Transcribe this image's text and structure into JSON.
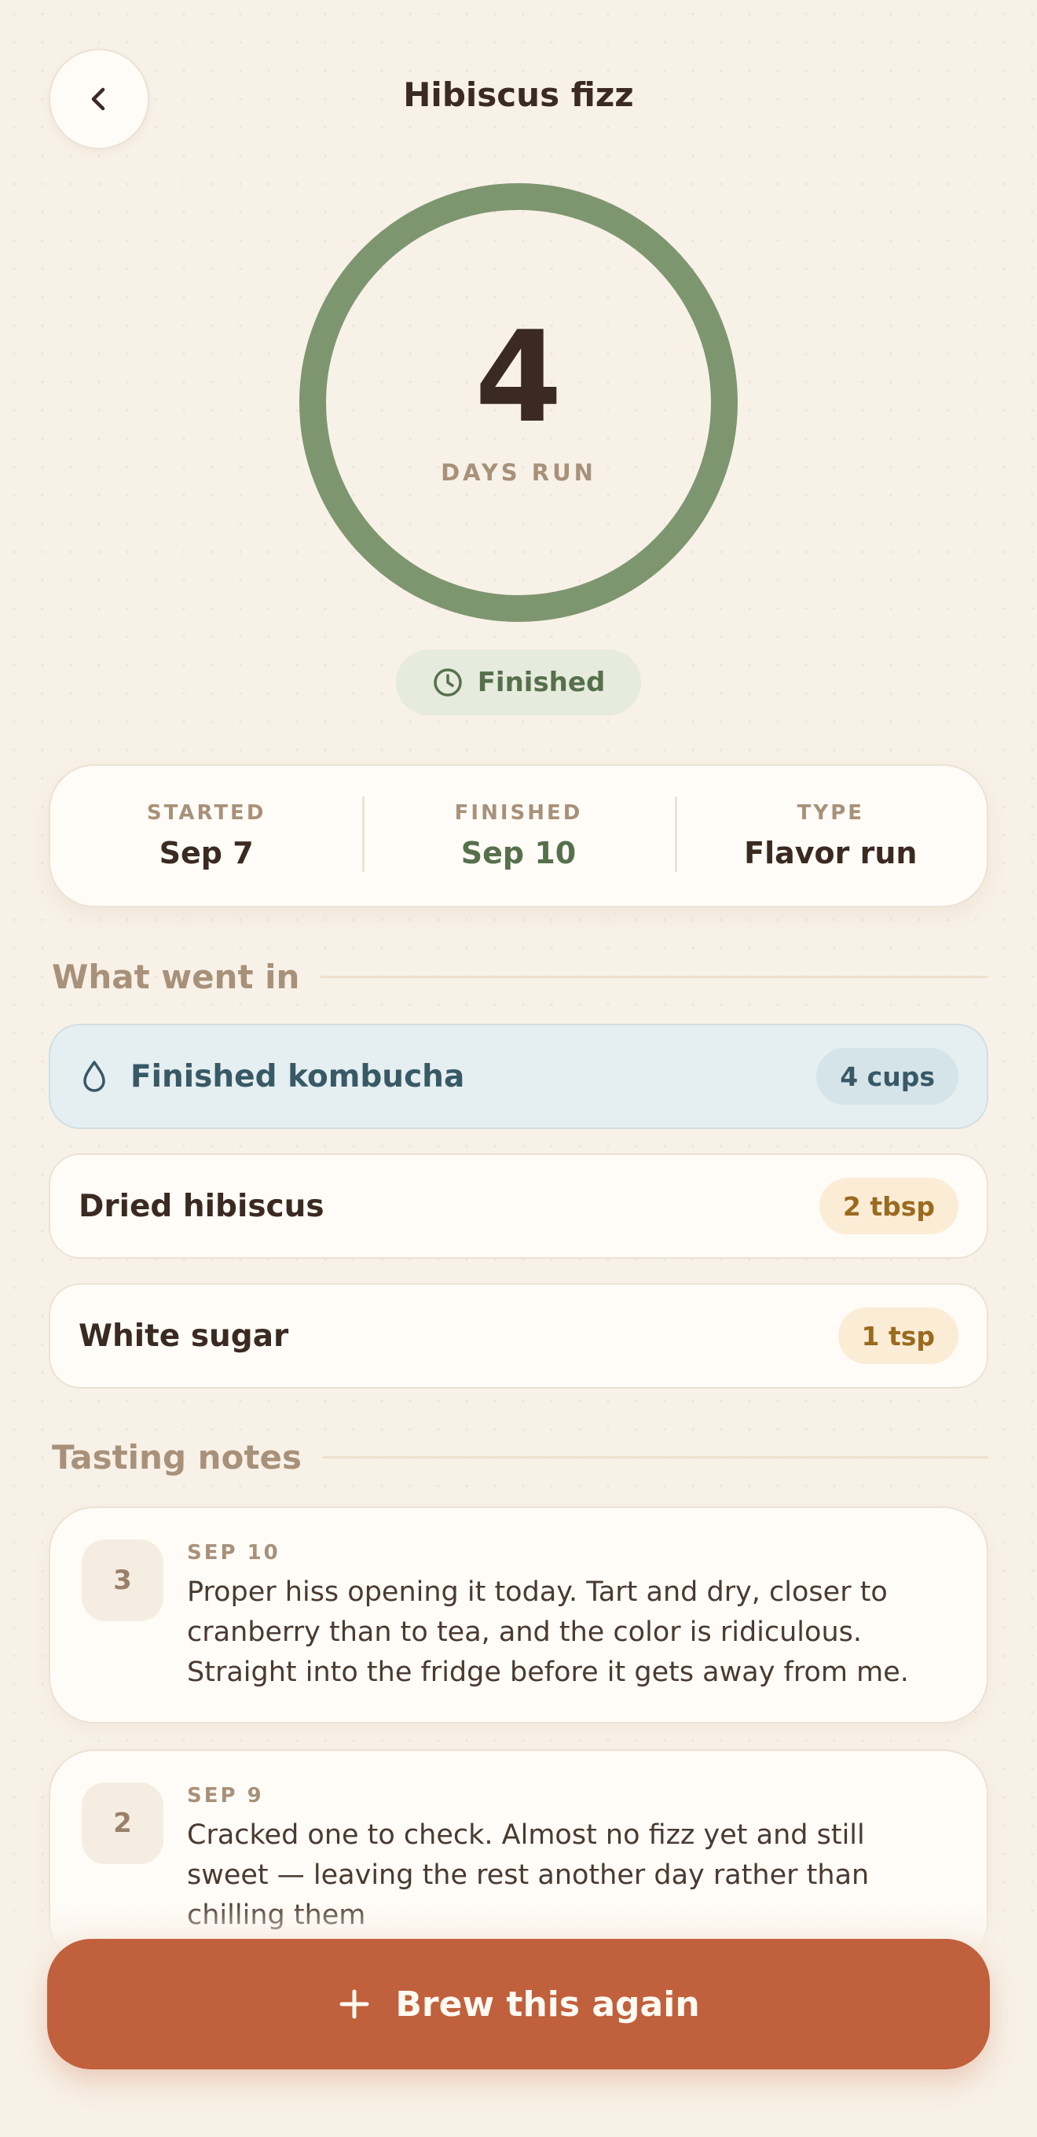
{
  "header": {
    "title": "Hibiscus fizz",
    "back_icon": "chevron-left-icon"
  },
  "progress": {
    "value": 4,
    "label": "DAYS RUN",
    "ring_fill_fraction": 1.0,
    "ring_color": "#7d9670"
  },
  "status": {
    "label": "Finished",
    "icon": "clock-icon",
    "color": "#56704c"
  },
  "stats": [
    {
      "label": "STARTED",
      "value": "Sep 7"
    },
    {
      "label": "FINISHED",
      "value": "Sep 10"
    },
    {
      "label": "TYPE",
      "value": "Flavor run"
    }
  ],
  "ingredients": {
    "heading": "What went in",
    "items": [
      {
        "name": "Finished kombucha",
        "qty": "4 cups",
        "icon": "droplet-icon"
      },
      {
        "name": "Dried hibiscus",
        "qty": "2 tbsp"
      },
      {
        "name": "White sugar",
        "qty": "1 tsp"
      }
    ]
  },
  "notes": {
    "heading": "Tasting notes",
    "items": [
      {
        "day": "3",
        "date": "SEP 10",
        "text": "Proper hiss opening it today. Tart and dry, closer to cranberry than to tea, and the color is ridiculous. Straight into the fridge before it gets away from me."
      },
      {
        "day": "2",
        "date": "SEP 9",
        "text": "Cracked one to check. Almost no fizz yet and still sweet — leaving the rest another day rather than chilling them"
      }
    ]
  },
  "cta": {
    "label": "Brew this again",
    "icon": "plus-icon",
    "color": "#c1603d"
  }
}
